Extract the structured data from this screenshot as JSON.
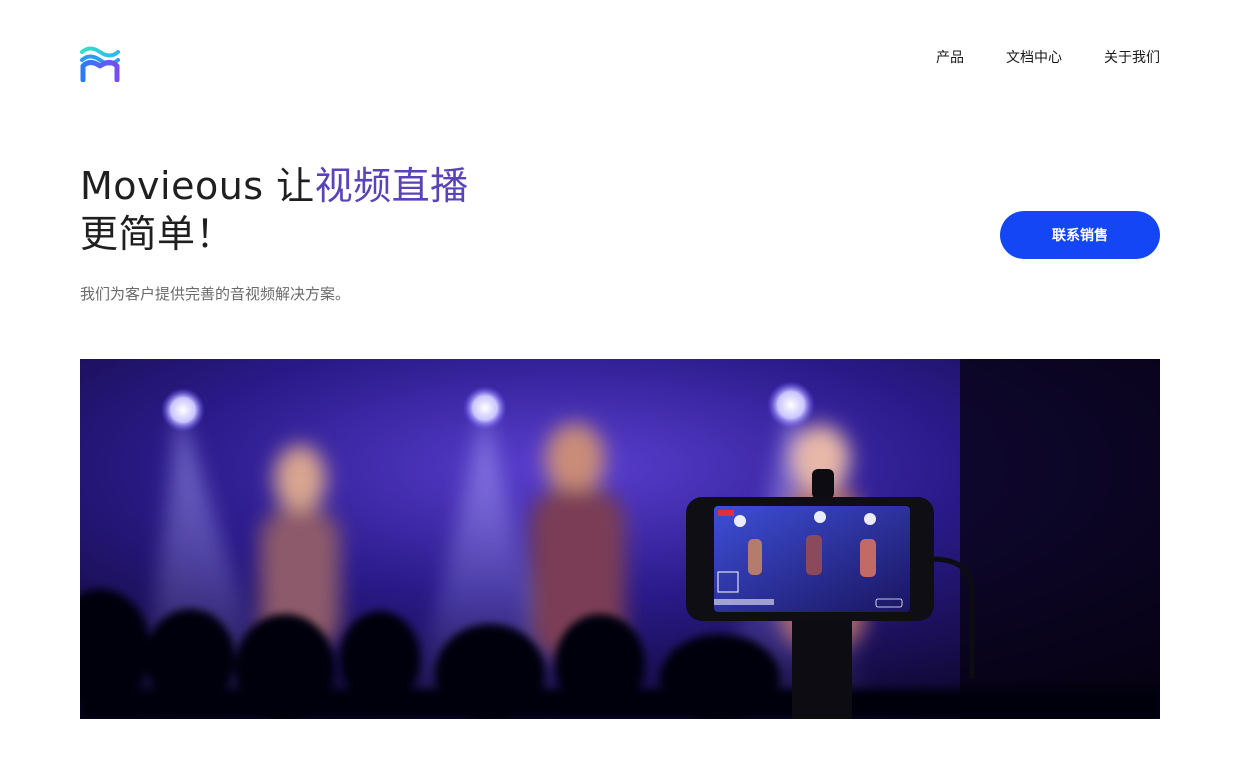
{
  "header": {
    "logo_icon": "movieous-m-logo-icon",
    "nav": [
      {
        "label": "产品"
      },
      {
        "label": "文档中心"
      },
      {
        "label": "关于我们"
      }
    ]
  },
  "hero": {
    "title_prefix": "Movieous 让",
    "title_accent": "视频直播",
    "title_line2": "更简单！",
    "subtitle": "我们为客户提供完善的音视频解决方案。",
    "accent_color": "#5a43b8"
  },
  "cta": {
    "label": "联系销售",
    "color": "#1446f5"
  },
  "banner": {
    "description_icon": "concert-phone-live-photo"
  }
}
